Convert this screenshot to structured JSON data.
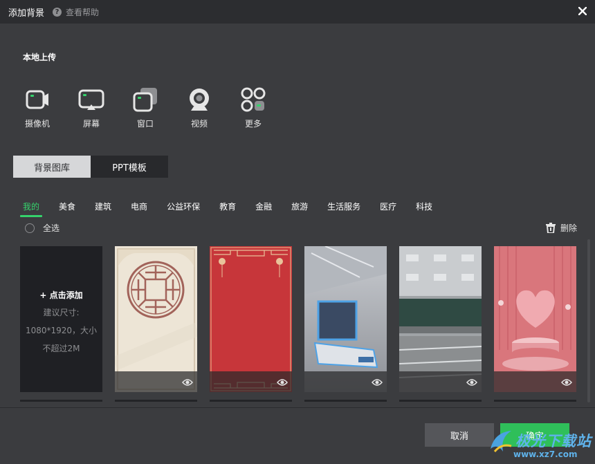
{
  "window": {
    "title": "添加背景",
    "help_label": "查看帮助",
    "help_icon": "?"
  },
  "local_upload": {
    "title": "本地上传",
    "items": [
      {
        "name": "camera",
        "label": "摄像机"
      },
      {
        "name": "screen",
        "label": "屏幕"
      },
      {
        "name": "window",
        "label": "窗口"
      },
      {
        "name": "video",
        "label": "视频"
      },
      {
        "name": "more",
        "label": "更多"
      }
    ]
  },
  "source_tabs": [
    {
      "label": "背景图库",
      "active": true
    },
    {
      "label": "PPT模板",
      "active": false
    }
  ],
  "categories": [
    "我的",
    "美食",
    "建筑",
    "电商",
    "公益环保",
    "教育",
    "金融",
    "旅游",
    "生活服务",
    "医疗",
    "科技"
  ],
  "active_category": "我的",
  "toolbar": {
    "select_all": "全选",
    "delete": "删除"
  },
  "add_card": {
    "title": "+ 点击添加",
    "hint_line1": "建议尺寸:",
    "hint_line2": "1080*1920，大小",
    "hint_line3": "不超过2M"
  },
  "thumbnails": [
    {
      "theme": "chinese-window-cream"
    },
    {
      "theme": "chinese-red-festive"
    },
    {
      "theme": "tech-studio-desk"
    },
    {
      "theme": "classroom"
    },
    {
      "theme": "pink-heart-stage"
    }
  ],
  "buttons": {
    "cancel": "取消",
    "ok": "确定"
  },
  "watermark": {
    "text": "极光下载站",
    "url": "www.xz7.com"
  },
  "colors": {
    "accent": "#35d36c",
    "ok_button": "#2fbf5a",
    "background": "#3b3c3f",
    "titlebar": "#2c2d30"
  }
}
